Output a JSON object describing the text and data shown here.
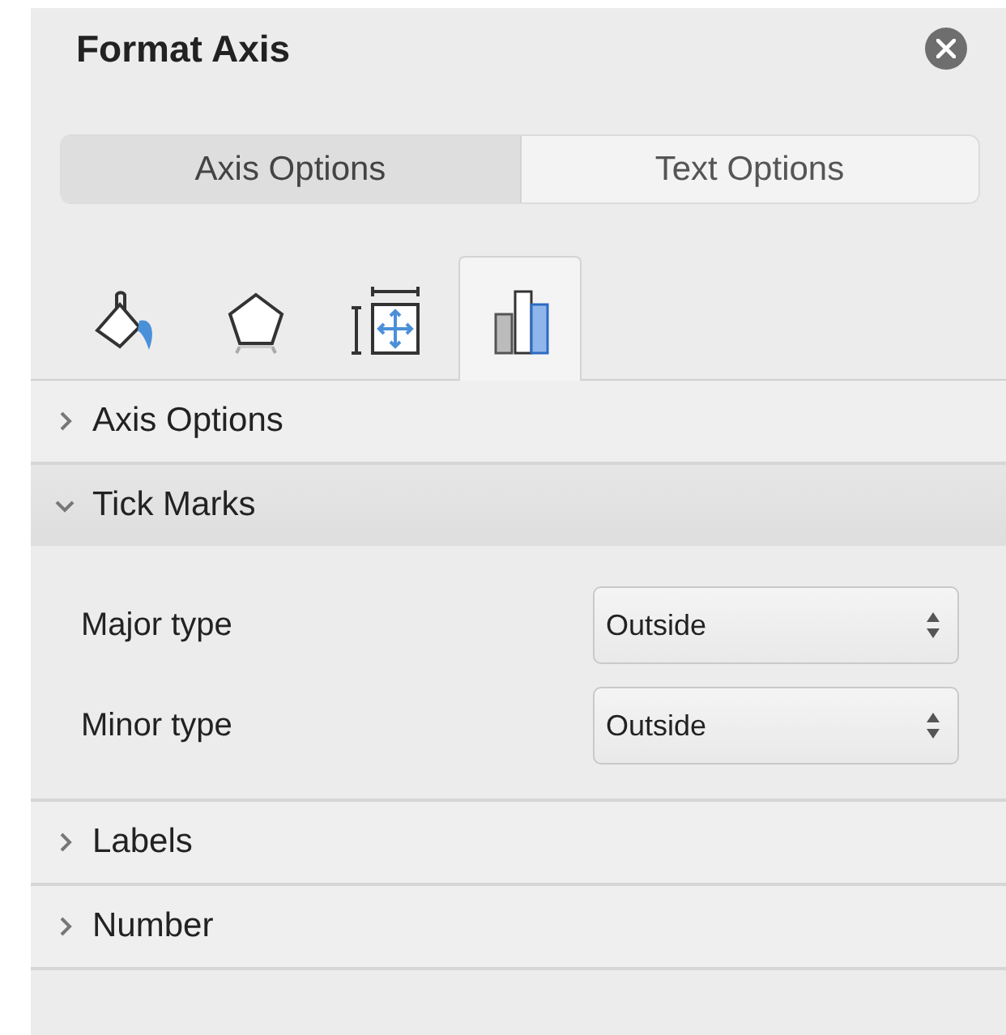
{
  "panel": {
    "title": "Format Axis"
  },
  "segments": [
    {
      "label": "Axis Options",
      "selected": true
    },
    {
      "label": "Text Options",
      "selected": false
    }
  ],
  "icon_tabs": [
    {
      "kind": "fill",
      "selected": false
    },
    {
      "kind": "effects",
      "selected": false
    },
    {
      "kind": "size",
      "selected": false
    },
    {
      "kind": "options",
      "selected": true
    }
  ],
  "sections": [
    {
      "title": "Axis Options",
      "expanded": false
    },
    {
      "title": "Tick Marks",
      "expanded": true,
      "fields": [
        {
          "label": "Major type",
          "value": "Outside"
        },
        {
          "label": "Minor type",
          "value": "Outside"
        }
      ]
    },
    {
      "title": "Labels",
      "expanded": false
    },
    {
      "title": "Number",
      "expanded": false
    }
  ]
}
